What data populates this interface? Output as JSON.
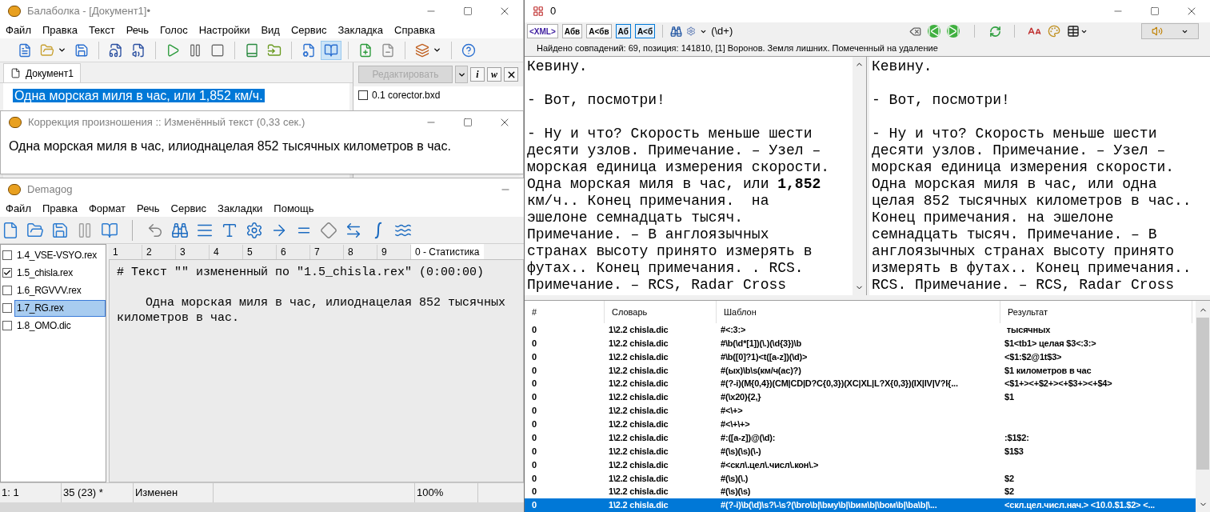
{
  "balabolka": {
    "title": "Балаболка - [Документ1]•",
    "menu": [
      "Файл",
      "Правка",
      "Текст",
      "Речь",
      "Голос",
      "Настройки",
      "Вид",
      "Сервис",
      "Закладка",
      "Справка"
    ],
    "toolbar": [
      [
        {
          "kind": "button",
          "selected": false
        },
        {
          "kind": "dropdown",
          "selected": false
        },
        {
          "kind": "button",
          "selected": false
        }
      ],
      [
        {
          "kind": "button",
          "selected": false
        },
        {
          "kind": "button",
          "selected": false
        }
      ],
      [
        {
          "kind": "button",
          "selected": false
        },
        {
          "kind": "button",
          "selected": false
        },
        {
          "kind": "button",
          "selected": false
        }
      ],
      [
        {
          "kind": "button",
          "selected": false
        },
        {
          "kind": "button",
          "selected": false
        }
      ],
      [
        {
          "kind": "button",
          "selected": false
        },
        {
          "kind": "button",
          "selected": true
        }
      ],
      [
        {
          "kind": "button",
          "selected": false
        },
        {
          "kind": "button",
          "selected": false
        }
      ],
      [
        {
          "kind": "dropdown",
          "selected": false
        }
      ],
      [
        {
          "kind": "button",
          "selected": false
        }
      ]
    ],
    "tab": {
      "label": "Документ1",
      "selected": true
    },
    "document": {
      "text": "Одна морская миля в час, или 1,852 км/ч.",
      "selected": true
    },
    "panel": {
      "edit_button": {
        "label": "Редактировать",
        "disabled": true
      },
      "info_button": "i",
      "word_button": "w",
      "items": [
        {
          "label": "0.1 corector.bxd",
          "checked": false
        }
      ]
    }
  },
  "correction": {
    "title": "Коррекция произношения :: Изменённый текст (0,33 сек.)",
    "text": "Одна морская миля в час, илиоднацелая 852 тысячных километров в час."
  },
  "demagog": {
    "title": "Demagog",
    "menu": [
      "Файл",
      "Правка",
      "Формат",
      "Речь",
      "Сервис",
      "Закладки",
      "Помощь"
    ],
    "files": [
      {
        "label": "1.4_VSE-VSYO.rex",
        "checked": false,
        "selected": false
      },
      {
        "label": "1.5_chisla.rex",
        "checked": true,
        "selected": false
      },
      {
        "label": "1.6_RGVVV.rex",
        "checked": false,
        "selected": false
      },
      {
        "label": "1.7_RG.rex",
        "checked": false,
        "selected": true
      },
      {
        "label": "1.8_OMO.dic",
        "checked": false,
        "selected": false
      }
    ],
    "tabs": [
      {
        "label": "1",
        "selected": false
      },
      {
        "label": "2",
        "selected": false
      },
      {
        "label": "3",
        "selected": false
      },
      {
        "label": "4",
        "selected": false
      },
      {
        "label": "5",
        "selected": false
      },
      {
        "label": "6",
        "selected": false
      },
      {
        "label": "7",
        "selected": false
      },
      {
        "label": "8",
        "selected": false
      },
      {
        "label": "9",
        "selected": false
      },
      {
        "label": "0 - Статистика",
        "selected": true
      }
    ],
    "heading": "# Текст \"\" измененный по \"1.5_chisla.rex\" (0:00:00)",
    "body": "Одна морская миля в час, илиоднацелая 852 тысячных километров в час.",
    "status_bar": [
      "1: 1",
      "35 (23) *",
      "Изменен",
      "100%"
    ]
  },
  "editor": {
    "title": "0",
    "format_buttons": [
      {
        "label": "<XML>",
        "selected": false
      },
      {
        "label": "Абв",
        "selected": false
      },
      {
        "label": "А<бв",
        "selected": false
      },
      {
        "label": "Аб",
        "selected": true
      },
      {
        "label": "А<б",
        "selected": true
      }
    ],
    "search_pattern": "(\\d+)",
    "status": "Найдено совпадений: 69, позиция: 141810, [1] Воронов. Земля лишних. Помеченный на удаление",
    "left_pane": [
      "Кевину.",
      "- Вот, посмотри!",
      "- Ну и что? Скорость меньше шести десяти узлов. Примечание. – Узел – морская единица измерения скорости. Одна морская миля в час, или **1,852** км/ч.. Конец примечания.  на эшелоне семнадцать тысяч. Примечание. – В англоязычных странах высоту принято измерять в футах.. Конец примечания. . RCS. Примечание. – RCS, Radar Cross"
    ],
    "right_pane": [
      "Кевину.",
      "- Вот, посмотри!",
      "- Ну и что? Скорость меньше шести десяти узлов. Примечание. – Узел – морская единица измерения скорости. Одна морская миля в час, или одна целая 852 тысячных километров в час.. Конец примечания. на эшелоне семнадцать тысяч. Примечание. – В англоязычных странах высоту принято измерять в футах.. Конец примечания.. RCS. Примечание. – RCS, Radar Cross"
    ],
    "table": {
      "columns": [
        "#",
        "Словарь",
        "Шаблон",
        "Результат"
      ],
      "rows": [
        {
          "num": "0",
          "dictionary": "1\\2.2 chisla.dic",
          "pattern": "#<:3:>",
          "result": " тысячных",
          "selected": false
        },
        {
          "num": "0",
          "dictionary": "1\\2.2 chisla.dic",
          "pattern": "#\\b(\\d*[1])(\\.)(\\d{3})\\b",
          "result": "$1<tb1> целая $3<:3:>",
          "selected": false
        },
        {
          "num": "0",
          "dictionary": "1\\2.2 chisla.dic",
          "pattern": "#\\b([0]?1)<t([a-z])(\\d)>",
          "result": "<$1:$2@1t$3>",
          "selected": false
        },
        {
          "num": "0",
          "dictionary": "1\\2.2 chisla.dic",
          "pattern": "#(ых)\\b\\s(км/ч(ас)?)",
          "result": "$1 километров в час",
          "selected": false
        },
        {
          "num": "0",
          "dictionary": "1\\2.2 chisla.dic",
          "pattern": "#(?-i)(M{0,4})(CM|CD|D?C{0,3})(XC|XL|L?X{0,3})(IX|IV|V?I{...",
          "result": "<$1+><+$2+><+$3+><+$4>",
          "selected": false
        },
        {
          "num": "0",
          "dictionary": "1\\2.2 chisla.dic",
          "pattern": "#(\\x20){2,}",
          "result": "$1",
          "selected": false
        },
        {
          "num": "0",
          "dictionary": "1\\2.2 chisla.dic",
          "pattern": "#<\\+>",
          "selected": false
        },
        {
          "num": "0",
          "dictionary": "1\\2.2 chisla.dic",
          "pattern": "#<\\+\\+>",
          "selected": false
        },
        {
          "num": "0",
          "dictionary": "1\\2.2 chisla.dic",
          "pattern": "#:([a-z])@(\\d):",
          "result": ":$1$2:",
          "selected": false
        },
        {
          "num": "0",
          "dictionary": "1\\2.2 chisla.dic",
          "pattern": "#(\\s)(\\s)(\\-)",
          "result": "$1$3",
          "selected": false
        },
        {
          "num": "0",
          "dictionary": "1\\2.2 chisla.dic",
          "pattern": "#<скл\\.цел\\.числ\\.кон\\.>",
          "selected": false
        },
        {
          "num": "0",
          "dictionary": "1\\2.2 chisla.dic",
          "pattern": "#(\\s)(\\.)",
          "result": "$2",
          "selected": false
        },
        {
          "num": "0",
          "dictionary": "1\\2.2 chisla.dic",
          "pattern": "#(\\s)(\\s)",
          "result": "$2",
          "selected": false
        },
        {
          "num": "0",
          "dictionary": "1\\2.2 chisla.dic",
          "pattern": "#(?-i)\\b(\\d)\\s?\\-\\s?(\\bго\\b|\\bму\\b|\\bим\\b|\\bом\\b|\\bа\\b|\\...",
          "result": "<скл.цел.числ.нач.> <10.0.$1.$2> <...",
          "selected": true
        }
      ]
    }
  }
}
